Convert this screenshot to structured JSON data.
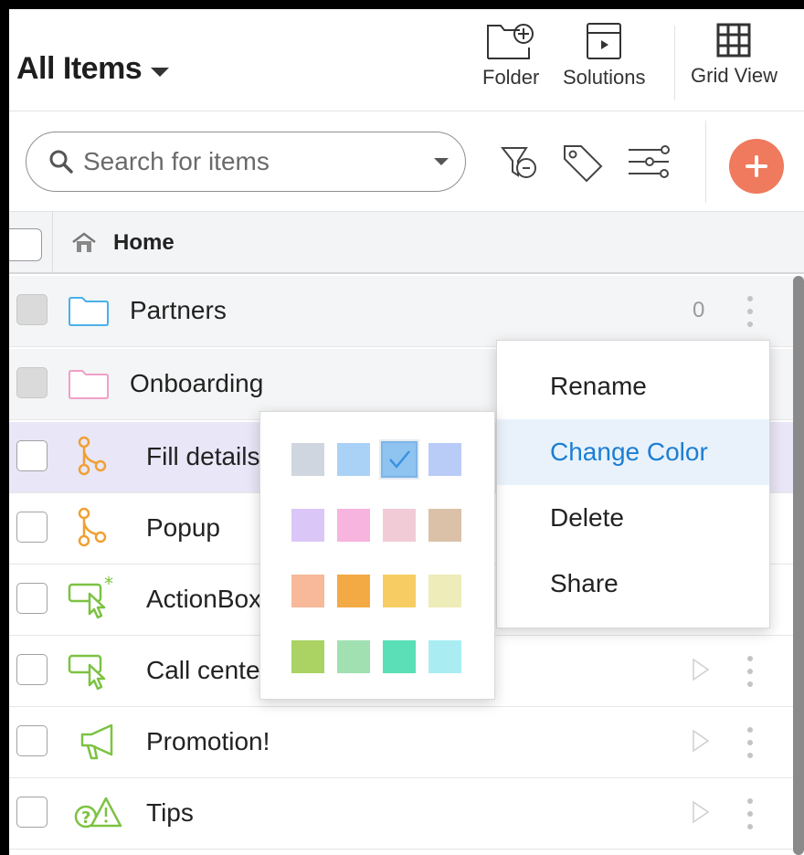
{
  "header": {
    "title": "All Items",
    "buttons": {
      "folder": "Folder",
      "solutions": "Solutions",
      "grid_view": "Grid View"
    }
  },
  "toolbar": {
    "search_placeholder": "Search for items",
    "icons": [
      "filter-icon",
      "tag-icon",
      "sliders-icon",
      "plus-icon"
    ],
    "add_button_color": "#ef7a5d"
  },
  "breadcrumb": {
    "home": "Home"
  },
  "list": {
    "folders": [
      {
        "name": "Partners",
        "count": "0",
        "icon": "folder-icon",
        "color": "#4ab0e8"
      },
      {
        "name": "Onboarding",
        "icon": "folder-icon",
        "color": "#f0a0c8"
      }
    ],
    "items": [
      {
        "name": "Fill details",
        "icon": "flow-icon",
        "color": "#f0a030"
      },
      {
        "name": "Popup",
        "icon": "flow-icon",
        "color": "#f0a030"
      },
      {
        "name": "ActionBox",
        "icon": "pointer-star-icon",
        "color": "#7cc242"
      },
      {
        "name": "Call center",
        "icon": "pointer-icon",
        "color": "#7cc242"
      },
      {
        "name": "Promotion!",
        "icon": "megaphone-icon",
        "color": "#7cc242"
      },
      {
        "name": "Tips",
        "icon": "tips-icon",
        "color": "#7cc242"
      }
    ]
  },
  "context_menu": {
    "items": [
      "Rename",
      "Change Color",
      "Delete",
      "Share"
    ],
    "active": "Change Color",
    "active_color": "#1b7ed4"
  },
  "color_picker": {
    "selected_index": 2,
    "colors": [
      "#cfd6df",
      "#a9d2f6",
      "#8fc4f0",
      "#b9ccf8",
      "#dac7f7",
      "#f7b4df",
      "#f1ccd6",
      "#dbc1a8",
      "#f7b99a",
      "#f4aa44",
      "#f7cd63",
      "#eeecb8",
      "#aad363",
      "#a1e0b1",
      "#5adfb6",
      "#a9edf3"
    ]
  }
}
